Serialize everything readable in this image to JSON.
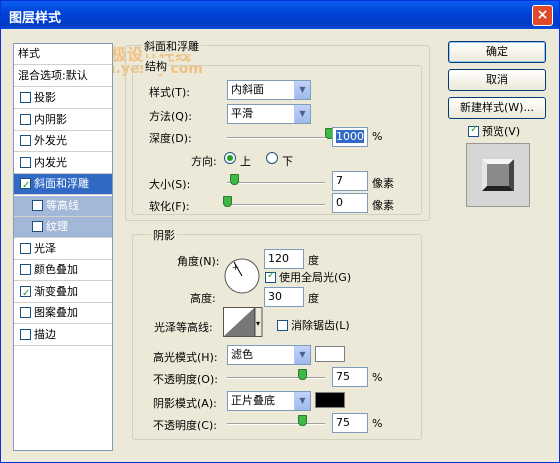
{
  "window": {
    "title": "图层样式",
    "close_glyph": "×"
  },
  "watermark": {
    "line1": "天极设计在线",
    "line2": "design.yesky.com"
  },
  "sidebar": {
    "header": "样式",
    "blend": "混合选项:默认",
    "items": [
      {
        "label": "投影",
        "checked": false
      },
      {
        "label": "内阴影",
        "checked": false
      },
      {
        "label": "外发光",
        "checked": false
      },
      {
        "label": "内发光",
        "checked": false
      },
      {
        "label": "斜面和浮雕",
        "checked": true
      },
      {
        "label": "等高线",
        "checked": false
      },
      {
        "label": "纹理",
        "checked": false
      },
      {
        "label": "光泽",
        "checked": false
      },
      {
        "label": "颜色叠加",
        "checked": false
      },
      {
        "label": "渐变叠加",
        "checked": true
      },
      {
        "label": "图案叠加",
        "checked": false
      },
      {
        "label": "描边",
        "checked": false
      }
    ]
  },
  "bevel": {
    "group_title": "斜面和浮雕",
    "structure_title": "结构",
    "style_label": "样式(T):",
    "style_value": "内斜面",
    "method_label": "方法(Q):",
    "method_value": "平滑",
    "depth_label": "深度(D):",
    "depth_value": "1000",
    "depth_unit": "%",
    "depth_level": 1.0,
    "direction_label": "方向:",
    "dir_up": "上",
    "dir_down": "下",
    "size_label": "大小(S):",
    "size_value": "7",
    "size_unit": "像素",
    "size_level": 0.03,
    "soften_label": "软化(F):",
    "soften_value": "0",
    "soften_unit": "像素",
    "soften_level": 0.0
  },
  "shading": {
    "group_title": "阴影",
    "angle_label": "角度(N):",
    "angle_value": "120",
    "angle_unit": "度",
    "global_light_label": "使用全局光(G)",
    "altitude_label": "高度:",
    "altitude_value": "30",
    "altitude_unit": "度",
    "gloss_label": "光泽等高线:",
    "antialias_label": "消除锯齿(L)",
    "highlight_mode_label": "高光模式(H):",
    "highlight_mode_value": "滤色",
    "highlight_color": "#ffffff",
    "highlight_opacity_label": "不透明度(O):",
    "highlight_opacity_value": "75",
    "highlight_opacity_unit": "%",
    "highlight_opacity_level": 0.75,
    "shadow_mode_label": "阴影模式(A):",
    "shadow_mode_value": "正片叠底",
    "shadow_color": "#000000",
    "shadow_opacity_label": "不透明度(C):",
    "shadow_opacity_value": "75",
    "shadow_opacity_unit": "%",
    "shadow_opacity_level": 0.75
  },
  "buttons": {
    "ok": "确定",
    "cancel": "取消",
    "new_style": "新建样式(W)...",
    "preview": "预览(V)"
  },
  "icons": {
    "dropdown": "▼",
    "small_dropdown": "▾"
  }
}
